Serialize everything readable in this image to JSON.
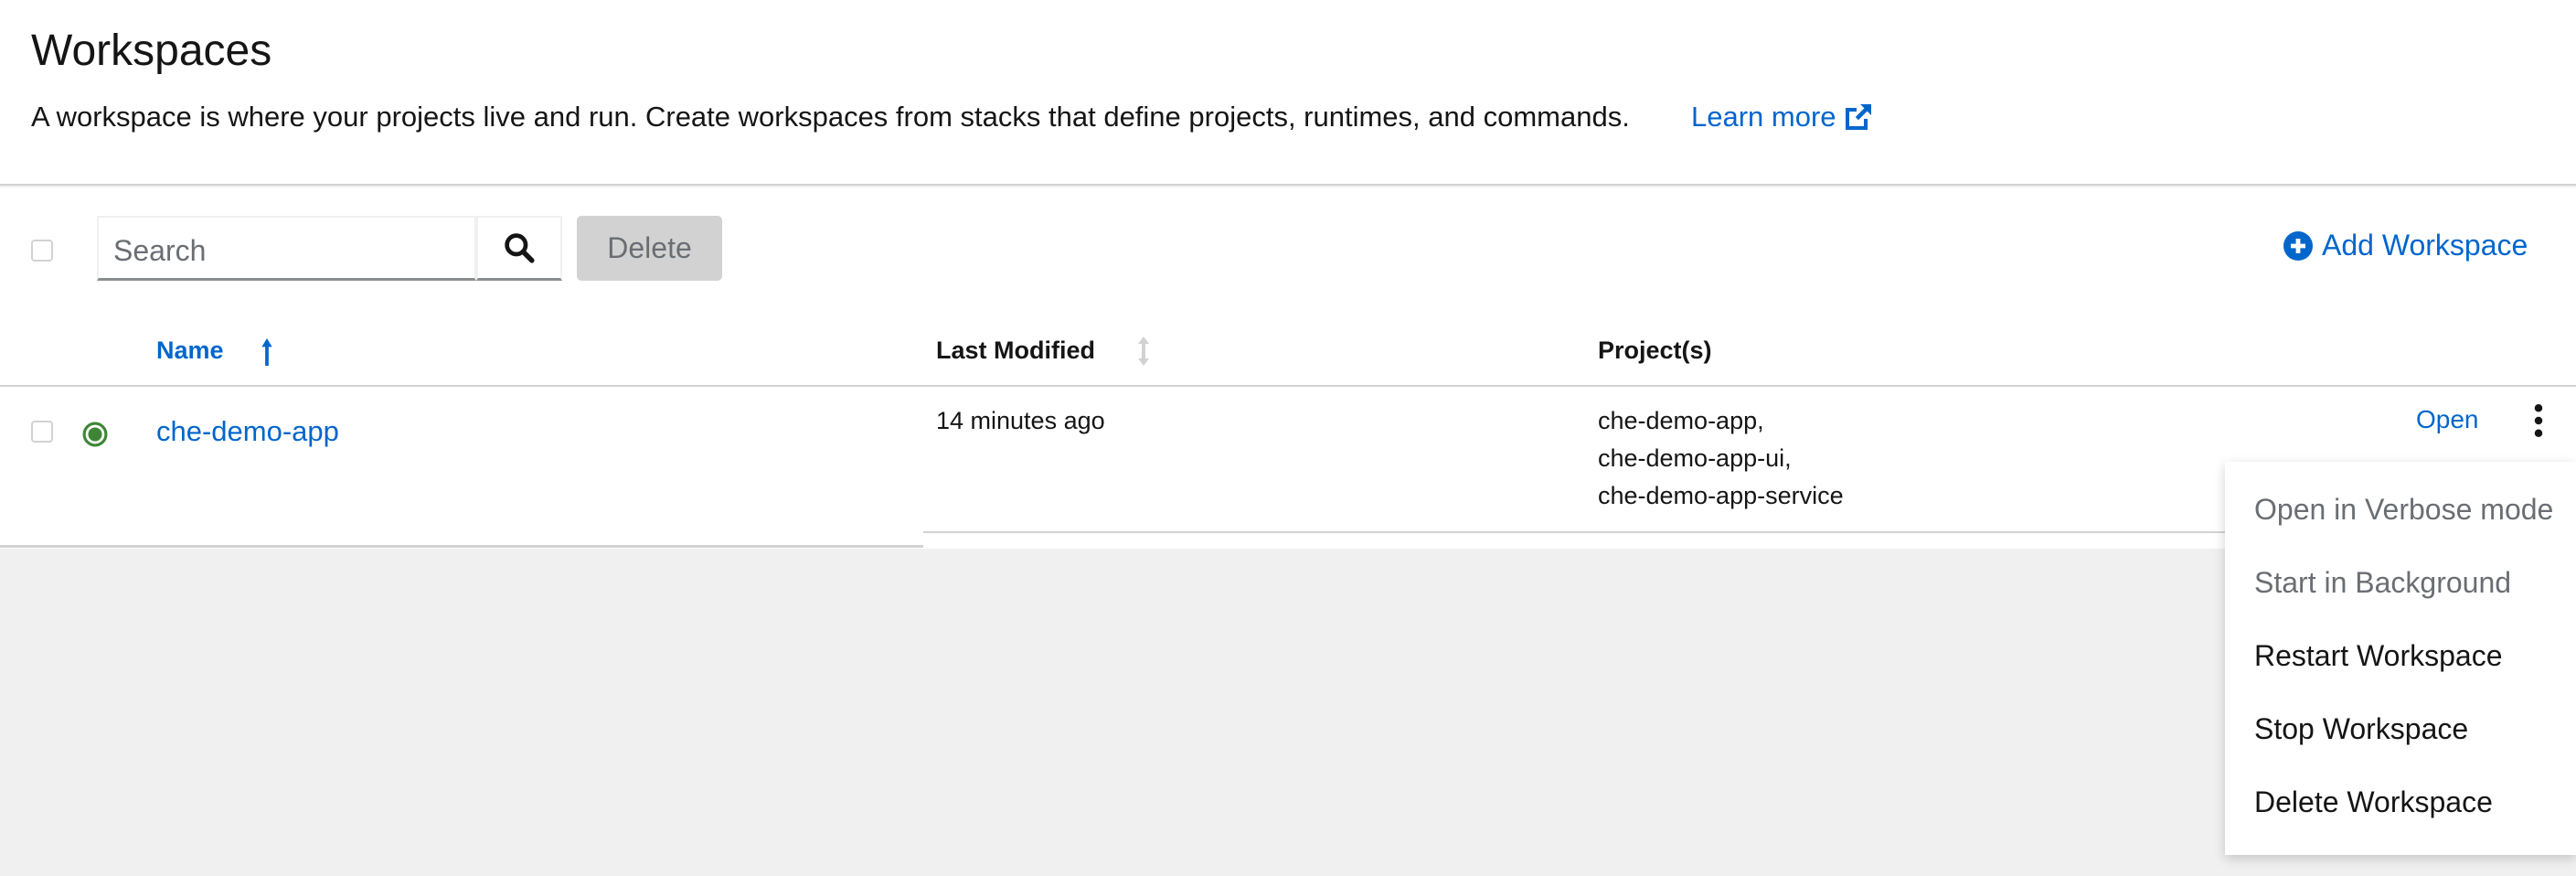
{
  "header": {
    "title": "Workspaces",
    "description": "A workspace is where your projects live and run. Create workspaces from stacks that define projects, runtimes, and commands.",
    "learn_more": "Learn more"
  },
  "toolbar": {
    "search_placeholder": "Search",
    "delete_label": "Delete",
    "add_label": "Add Workspace"
  },
  "table": {
    "columns": [
      "Name",
      "Last Modified",
      "Project(s)"
    ],
    "rows": [
      {
        "name": "che-demo-app",
        "status": "running",
        "last_modified": "14 minutes ago",
        "projects": [
          "che-demo-app,",
          "che-demo-app-ui,",
          "che-demo-app-service"
        ],
        "open_label": "Open"
      }
    ]
  },
  "menu": {
    "items": [
      {
        "label": "Open in Verbose mode",
        "disabled": true
      },
      {
        "label": "Start in Background",
        "disabled": true
      },
      {
        "label": "Restart Workspace",
        "disabled": false
      },
      {
        "label": "Stop Workspace",
        "disabled": false
      },
      {
        "label": "Delete Workspace",
        "disabled": false
      }
    ]
  },
  "colors": {
    "link": "#0066cc",
    "running": "#3e8635",
    "disabled_text": "#6a6e73"
  }
}
